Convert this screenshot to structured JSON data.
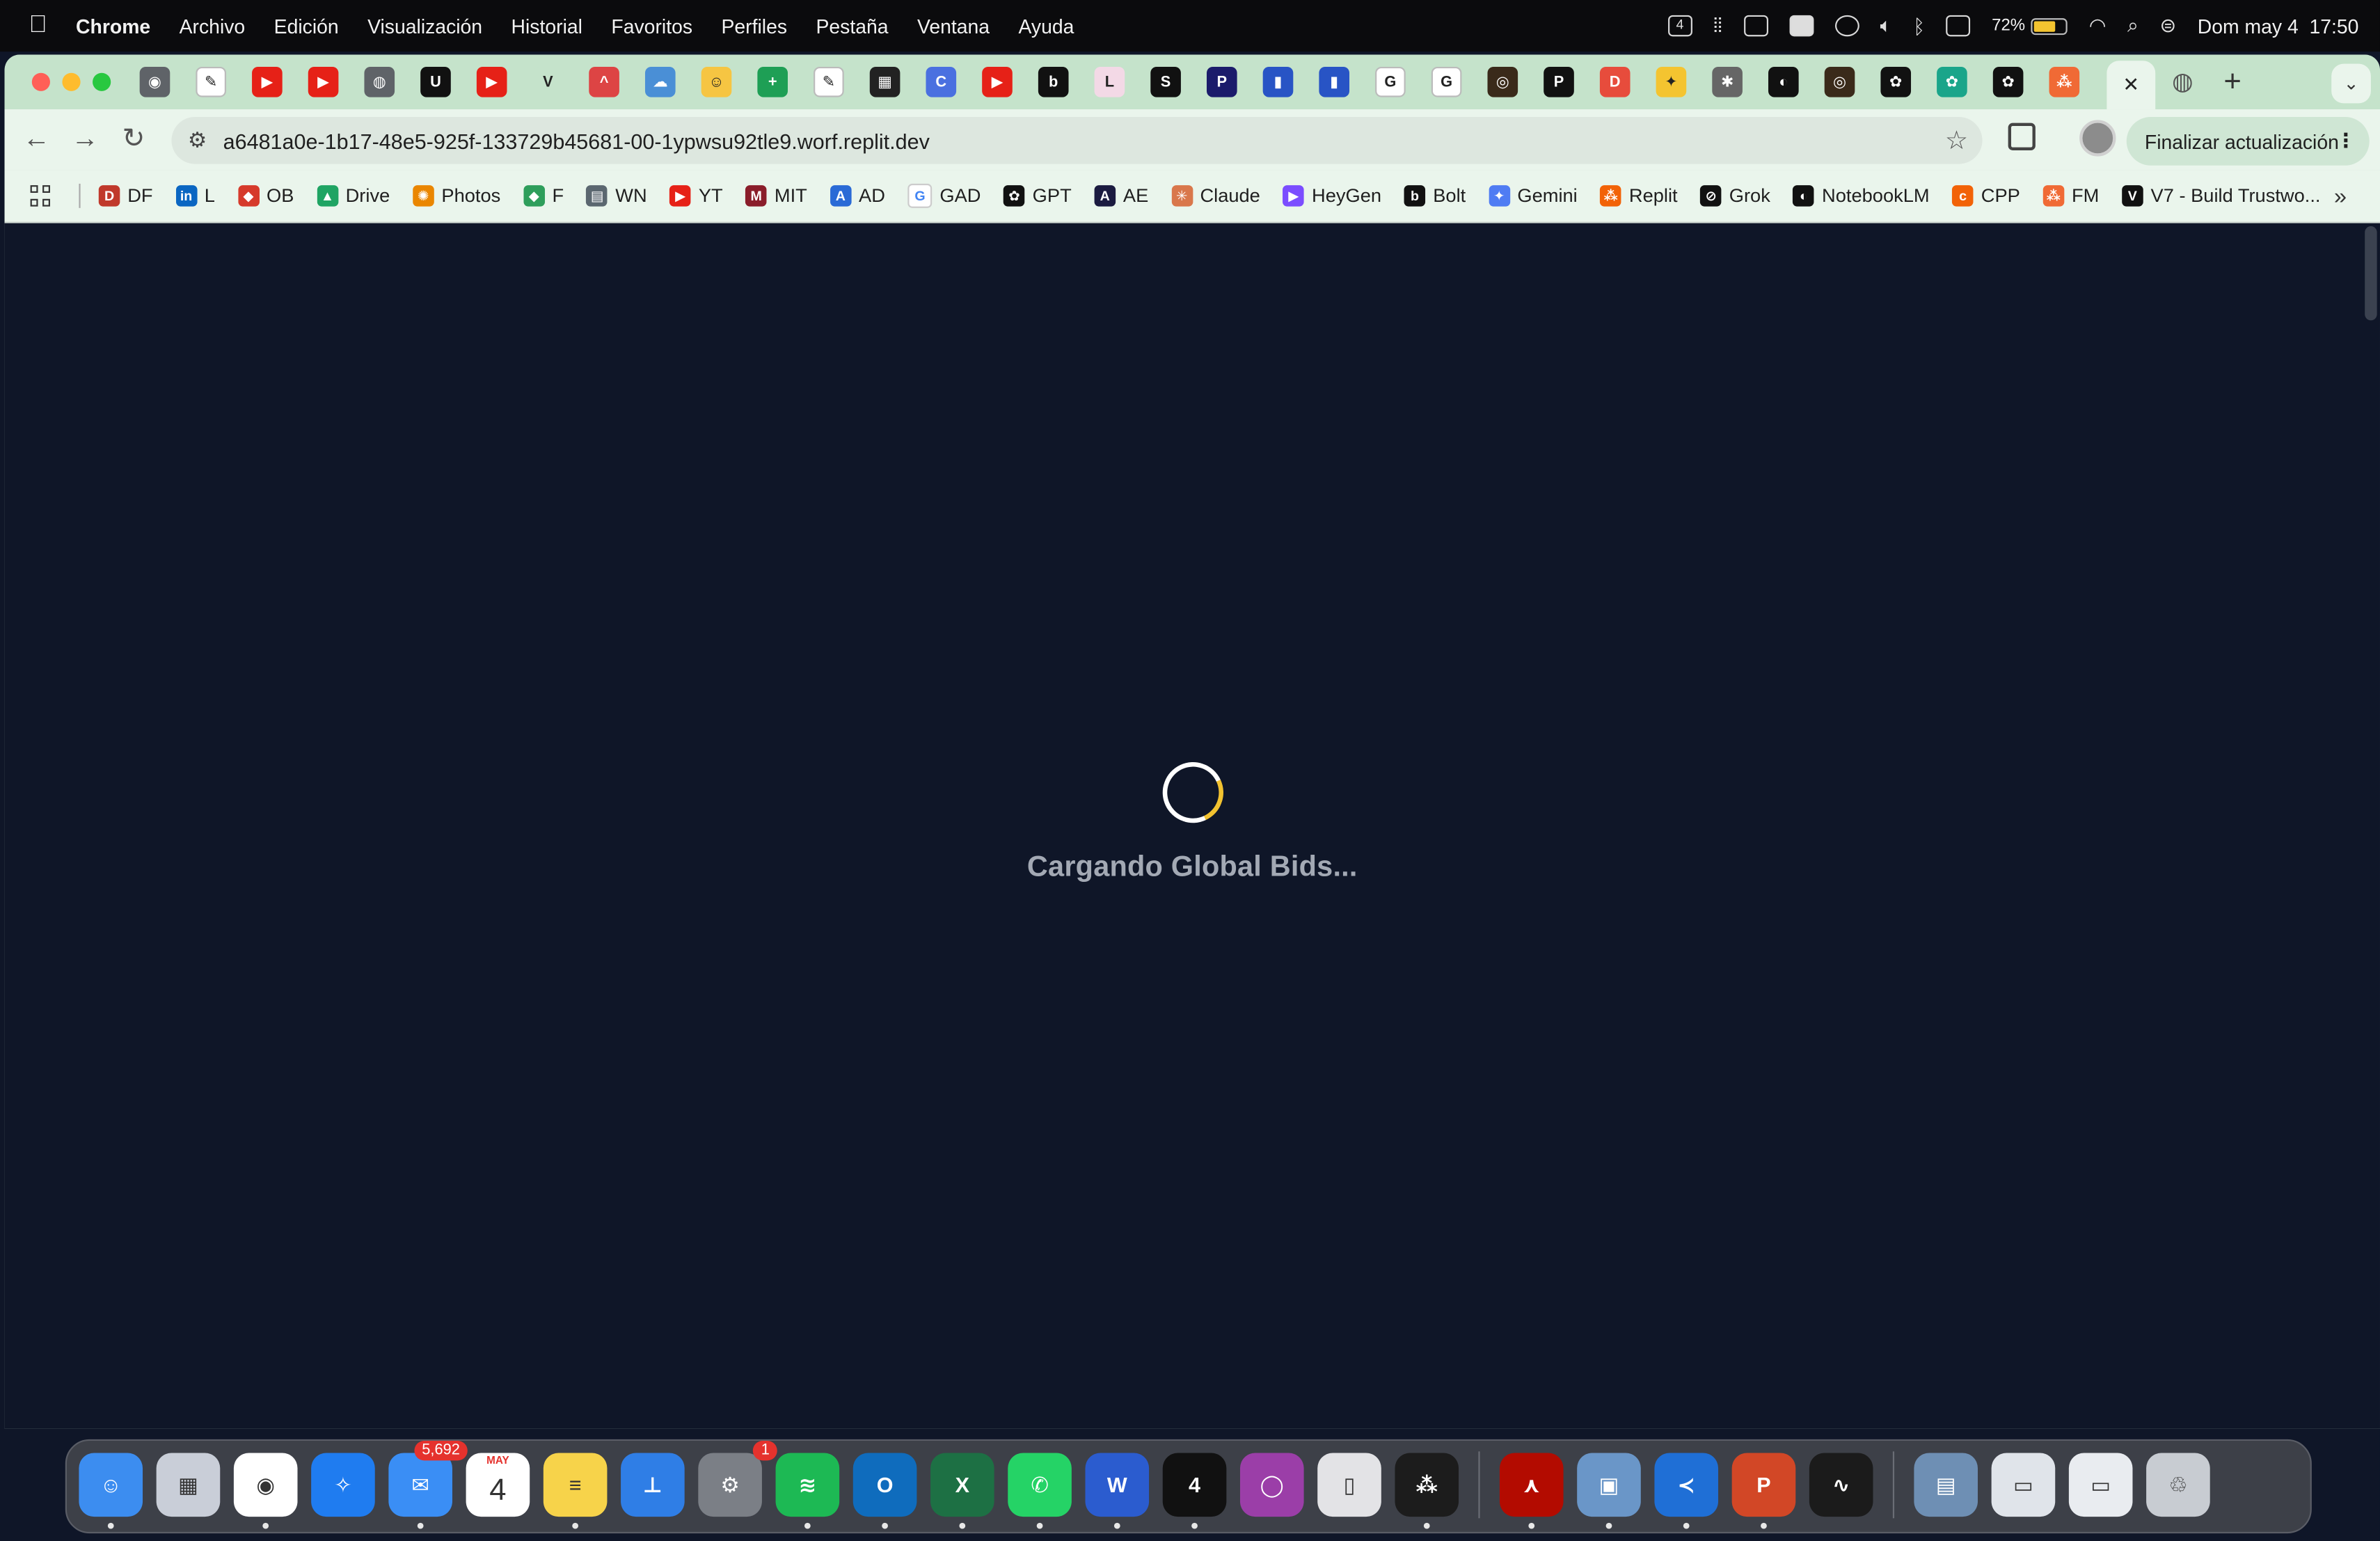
{
  "menubar": {
    "items": [
      "Chrome",
      "Archivo",
      "Edición",
      "Visualización",
      "Historial",
      "Favoritos",
      "Perfiles",
      "Pestaña",
      "Ventana",
      "Ayuda"
    ],
    "battery_percent": "72%",
    "battery_level": 0.72,
    "datetime": "Dom may 4  17:50",
    "calendar_badge": "4"
  },
  "tabs": {
    "favicons": [
      {
        "name": "chrome-icon",
        "color": "#5f6368",
        "text": "◉"
      },
      {
        "name": "replit-agent-icon",
        "color": "#ffffff",
        "text": "✎"
      },
      {
        "name": "youtube-icon",
        "color": "#e62117",
        "text": "▶"
      },
      {
        "name": "youtube-icon",
        "color": "#e62117",
        "text": "▶"
      },
      {
        "name": "globe-icon",
        "color": "#5f6368",
        "text": "◍"
      },
      {
        "name": "u-icon",
        "color": "#111111",
        "text": "U"
      },
      {
        "name": "youtube-icon",
        "color": "#e62117",
        "text": "▶"
      },
      {
        "name": "v-icon",
        "color": "#c5e3cb",
        "text": "V"
      },
      {
        "name": "hat-icon",
        "color": "#d44",
        "text": "^"
      },
      {
        "name": "cloud-icon",
        "color": "#4a8fd6",
        "text": "☁"
      },
      {
        "name": "face-icon",
        "color": "#f6c542",
        "text": "☺"
      },
      {
        "name": "sheets-icon",
        "color": "#1e9f55",
        "text": "+"
      },
      {
        "name": "replit-agent-icon",
        "color": "#ffffff",
        "text": "✎"
      },
      {
        "name": "grid-app-icon",
        "color": "#222",
        "text": "▦"
      },
      {
        "name": "c-icon",
        "color": "#4a70e0",
        "text": "C"
      },
      {
        "name": "youtube-icon",
        "color": "#e62117",
        "text": "▶"
      },
      {
        "name": "bolt-icon",
        "color": "#111",
        "text": "b"
      },
      {
        "name": "l-icon",
        "color": "#f3d9e6",
        "text": "L"
      },
      {
        "name": "s-icon",
        "color": "#111",
        "text": "S"
      },
      {
        "name": "p-icon",
        "color": "#1b1b6b",
        "text": "P"
      },
      {
        "name": "flag-icon",
        "color": "#2854c5",
        "text": "▮"
      },
      {
        "name": "flag-icon",
        "color": "#2854c5",
        "text": "▮"
      },
      {
        "name": "google-icon",
        "color": "#ffffff",
        "text": "G"
      },
      {
        "name": "google-icon",
        "color": "#ffffff",
        "text": "G"
      },
      {
        "name": "target-icon",
        "color": "#3a2a1a",
        "text": "◎"
      },
      {
        "name": "p-icon",
        "color": "#111",
        "text": "P"
      },
      {
        "name": "d-icon",
        "color": "#e74c3c",
        "text": "D"
      },
      {
        "name": "coin-icon",
        "color": "#f4c430",
        "text": "✦"
      },
      {
        "name": "gear-icon",
        "color": "#666",
        "text": "✱"
      },
      {
        "name": "notebook-icon",
        "color": "#111",
        "text": "◐"
      },
      {
        "name": "target-icon",
        "color": "#3a2a1a",
        "text": "◎"
      },
      {
        "name": "openai-icon",
        "color": "#111",
        "text": "✿"
      },
      {
        "name": "openai-icon",
        "color": "#1aa58a",
        "text": "✿"
      },
      {
        "name": "openai-icon",
        "color": "#111",
        "text": "✿"
      },
      {
        "name": "figma-icon",
        "color": "#f06a35",
        "text": "⁂"
      }
    ],
    "active_tab_close": "✕",
    "after_active_icon": "◍",
    "new_tab": "+",
    "tab_search": "⌄"
  },
  "toolbar": {
    "back": "←",
    "forward": "→",
    "reload": "↻",
    "url": "a6481a0e-1b17-48e5-925f-133729b45681-00-1ypwsu92tle9.worf.replit.dev",
    "site_info": "⚙",
    "bookmark_star": "☆",
    "update_label": "Finalizar actualización",
    "menu_dots": "⋮"
  },
  "bookmarks": [
    {
      "label": "DF",
      "icon": "df-icon",
      "color": "#c0392b",
      "glyph": "D"
    },
    {
      "label": "L",
      "icon": "linkedin-icon",
      "color": "#0a66c2",
      "glyph": "in"
    },
    {
      "label": "OB",
      "icon": "ob-icon",
      "color": "#d63a2b",
      "glyph": "◆"
    },
    {
      "label": "Drive",
      "icon": "drive-icon",
      "color": "#1fa463",
      "glyph": "▲"
    },
    {
      "label": "Photos",
      "icon": "photos-icon",
      "color": "#ea8600",
      "glyph": "✺"
    },
    {
      "label": "F",
      "icon": "f-icon",
      "color": "#2e9e5b",
      "glyph": "◆"
    },
    {
      "label": "WN",
      "icon": "wn-icon",
      "color": "#5b6770",
      "glyph": "▤"
    },
    {
      "label": "YT",
      "icon": "youtube-icon",
      "color": "#e62117",
      "glyph": "▶"
    },
    {
      "label": "MIT",
      "icon": "mit-icon",
      "color": "#8a1d2a",
      "glyph": "M"
    },
    {
      "label": "AD",
      "icon": "ad-icon",
      "color": "#2a6ad6",
      "glyph": "A"
    },
    {
      "label": "GAD",
      "icon": "google-icon",
      "color": "#ffffff",
      "glyph": "G"
    },
    {
      "label": "GPT",
      "icon": "openai-icon",
      "color": "#111111",
      "glyph": "✿"
    },
    {
      "label": "AE",
      "icon": "ae-icon",
      "color": "#1b1b40",
      "glyph": "A"
    },
    {
      "label": "Claude",
      "icon": "claude-icon",
      "color": "#d9774b",
      "glyph": "✳"
    },
    {
      "label": "HeyGen",
      "icon": "heygen-icon",
      "color": "#7b4dff",
      "glyph": "▶"
    },
    {
      "label": "Bolt",
      "icon": "bolt-icon",
      "color": "#111111",
      "glyph": "b"
    },
    {
      "label": "Gemini",
      "icon": "gemini-icon",
      "color": "#4f7cf3",
      "glyph": "✦"
    },
    {
      "label": "Replit",
      "icon": "replit-icon",
      "color": "#f26207",
      "glyph": "⁂"
    },
    {
      "label": "Grok",
      "icon": "grok-icon",
      "color": "#111111",
      "glyph": "⊘"
    },
    {
      "label": "NotebookLM",
      "icon": "notebooklm-icon",
      "color": "#111111",
      "glyph": "◐"
    },
    {
      "label": "CPP",
      "icon": "cpp-icon",
      "color": "#f26207",
      "glyph": "c"
    },
    {
      "label": "FM",
      "icon": "figma-icon",
      "color": "#f06a35",
      "glyph": "⁂"
    },
    {
      "label": "V7 - Build Trustwo...",
      "icon": "v7-icon",
      "color": "#111111",
      "glyph": "V"
    }
  ],
  "bookmarks_more": "»",
  "page": {
    "loading_text": "Cargando Global Bids..."
  },
  "dock": {
    "apps": [
      {
        "name": "finder-icon",
        "bg": "#3c8df0",
        "glyph": "☺",
        "dot": true
      },
      {
        "name": "launchpad-icon",
        "bg": "#c9ced8",
        "glyph": "▦",
        "dot": false
      },
      {
        "name": "chrome-dock-icon",
        "bg": "#ffffff",
        "glyph": "◉",
        "dot": true
      },
      {
        "name": "safari-icon",
        "bg": "#1f7cf0",
        "glyph": "✧",
        "dot": false
      },
      {
        "name": "mail-icon",
        "bg": "#3a8ef5",
        "glyph": "✉",
        "dot": true,
        "badge": "5,692"
      },
      {
        "name": "calendar-icon",
        "bg": "#ffffff",
        "glyph": "4",
        "dot": false,
        "top": "MAY"
      },
      {
        "name": "notes-icon",
        "bg": "#f7d34a",
        "glyph": "≡",
        "dot": true
      },
      {
        "name": "keynote-icon",
        "bg": "#2f7ee6",
        "glyph": "⊥",
        "dot": false
      },
      {
        "name": "system-settings-icon",
        "bg": "#7b7f86",
        "glyph": "⚙",
        "dot": false,
        "badge": "1"
      },
      {
        "name": "spotify-icon",
        "bg": "#1db954",
        "glyph": "≋",
        "dot": true
      },
      {
        "name": "outlook-icon",
        "bg": "#0f6cbd",
        "glyph": "O",
        "dot": true
      },
      {
        "name": "excel-icon",
        "bg": "#1d7044",
        "glyph": "X",
        "dot": true
      },
      {
        "name": "whatsapp-icon",
        "bg": "#25d366",
        "glyph": "✆",
        "dot": true
      },
      {
        "name": "word-icon",
        "bg": "#2b5ccf",
        "glyph": "W",
        "dot": true
      },
      {
        "name": "calendar-4-icon",
        "bg": "#111111",
        "glyph": "4",
        "dot": true
      },
      {
        "name": "circle-app-icon",
        "bg": "#9b3ea8",
        "glyph": "◯",
        "dot": false
      },
      {
        "name": "iphone-mirroring-icon",
        "bg": "#e3e3e6",
        "glyph": "▯",
        "dot": false
      },
      {
        "name": "replit-dock-icon",
        "bg": "#1c1c1c",
        "glyph": "⁂",
        "dot": true
      },
      {
        "name": "acrobat-icon",
        "bg": "#b30b00",
        "glyph": "⋏",
        "dot": true
      },
      {
        "name": "preview-icon",
        "bg": "#6a96c8",
        "glyph": "▣",
        "dot": true
      },
      {
        "name": "vscode-icon",
        "bg": "#1f6fd6",
        "glyph": "≺",
        "dot": true
      },
      {
        "name": "powerpoint-icon",
        "bg": "#d24726",
        "glyph": "P",
        "dot": true
      },
      {
        "name": "activity-monitor-icon",
        "bg": "#1b1b1b",
        "glyph": "∿",
        "dot": false
      },
      {
        "name": "downloads-stack-icon",
        "bg": "#6e8fb4",
        "glyph": "▤",
        "dot": false
      },
      {
        "name": "documents-stack-icon",
        "bg": "#e0e4ea",
        "glyph": "▭",
        "dot": false
      },
      {
        "name": "pdf-stack-icon",
        "bg": "#e9ecf0",
        "glyph": "▭",
        "dot": false
      },
      {
        "name": "trash-icon",
        "bg": "#c8ccd2",
        "glyph": "♲",
        "dot": false
      }
    ]
  }
}
